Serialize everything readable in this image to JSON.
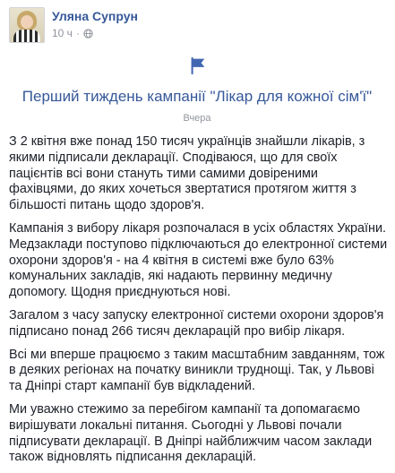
{
  "author": {
    "name": "Уляна Супрун",
    "time": "10 ч",
    "separator": "·"
  },
  "event_card": {
    "title": "Перший тиждень кампанії \"Лікар для кожної сім'ї\"",
    "date": "Вчера"
  },
  "post": {
    "paragraphs": [
      "З 2 квітня вже понад 150 тисяч українців знайшли лікарів, з якими підписали декларації. Сподіваюся, що для своїх пацієнтів всі вони стануть тими самими довіреними фахівцями, до яких хочеться звертатися протягом життя з більшості питань щодо здоров'я.",
      "Кампанія з вибору лікаря розпочалася в усіх областях України. Медзаклади поступово підключаються до електронної системи охорони здоров'я - на 4 квітня в системі вже було 63% комунальних закладів, які надають первинну медичну допомогу. Щодня приєднуються нові.",
      "Загалом з часу запуску електронної системи охорони здоров'я підписано понад 266 тисяч декларацій про вибір лікаря.",
      "Всі ми вперше працюємо з таким масштабним завданням, тож в деяких регіонах на початку виникли труднощі. Так, у Львові та Дніпрі старт кампанії був відкладений.",
      "Ми уважно стежимо за перебігом кампанії та допомагаємо вирішувати локальні питання. Сьогодні у Львові почали підписувати декларації. В Дніпрі найближчим часом заклади також відновлять підписання декларацій."
    ]
  },
  "colors": {
    "link": "#365899",
    "meta": "#90949c",
    "text": "#1d2129"
  },
  "icons": {
    "privacy": "globe-icon",
    "event": "flag-icon"
  }
}
